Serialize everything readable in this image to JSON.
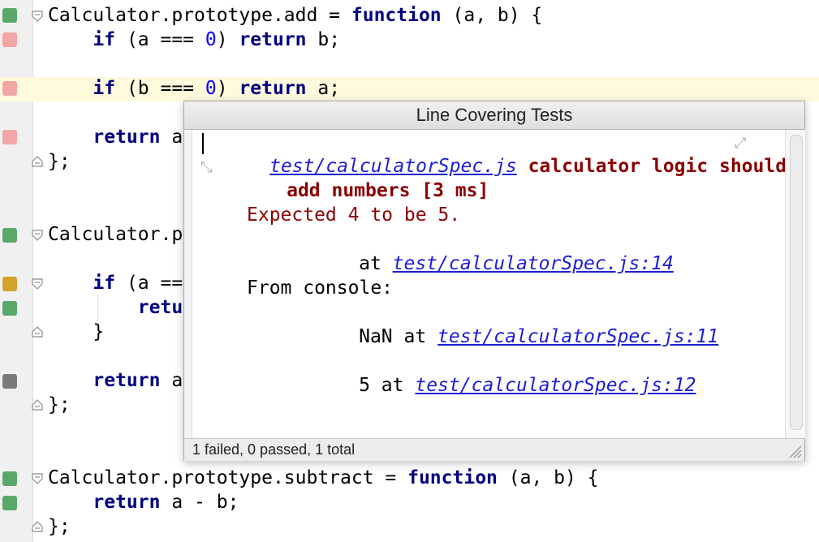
{
  "editor": {
    "lines": [
      {
        "id": "l1",
        "tokens": [
          [
            "",
            "Calculator.prototype.add = "
          ],
          [
            "kw",
            "function"
          ],
          [
            "",
            " (a, b) {"
          ]
        ]
      },
      {
        "id": "l2",
        "tokens": [
          [
            "",
            "    "
          ],
          [
            "kw",
            "if"
          ],
          [
            "",
            " (a === "
          ],
          [
            "num",
            "0"
          ],
          [
            "",
            ") "
          ],
          [
            "kw",
            "return"
          ],
          [
            "",
            " b;"
          ]
        ]
      },
      {
        "id": "l3",
        "tokens": [
          [
            "",
            "    "
          ],
          [
            "kw",
            "if"
          ],
          [
            "",
            " (b === "
          ],
          [
            "num",
            "0"
          ],
          [
            "",
            ") "
          ],
          [
            "kw",
            "return"
          ],
          [
            "",
            " a;"
          ]
        ]
      },
      {
        "id": "l4",
        "tokens": [
          [
            "",
            "    "
          ],
          [
            "kw",
            "return"
          ],
          [
            "",
            " a"
          ]
        ]
      },
      {
        "id": "l5",
        "tokens": [
          [
            "",
            "};"
          ]
        ]
      },
      {
        "id": "l6",
        "tokens": [
          [
            "",
            "Calculator.p"
          ]
        ]
      },
      {
        "id": "l7",
        "tokens": [
          [
            "",
            "    "
          ],
          [
            "kw",
            "if"
          ],
          [
            "",
            " (a =="
          ]
        ]
      },
      {
        "id": "l8",
        "tokens": [
          [
            "",
            "        "
          ],
          [
            "kw",
            "retu"
          ]
        ]
      },
      {
        "id": "l9",
        "tokens": [
          [
            "",
            "    }"
          ]
        ]
      },
      {
        "id": "l10",
        "tokens": [
          [
            "",
            "    "
          ],
          [
            "kw",
            "return"
          ],
          [
            "",
            " a"
          ]
        ]
      },
      {
        "id": "l11",
        "tokens": [
          [
            "",
            "};"
          ]
        ]
      },
      {
        "id": "l12",
        "tokens": [
          [
            "",
            "Calculator.prototype.subtract = "
          ],
          [
            "kw",
            "function"
          ],
          [
            "",
            " (a, b) {"
          ]
        ]
      },
      {
        "id": "l13",
        "tokens": [
          [
            "",
            "    "
          ],
          [
            "kw",
            "return"
          ],
          [
            "",
            " a - b;"
          ]
        ]
      },
      {
        "id": "l14",
        "tokens": [
          [
            "",
            "};"
          ]
        ]
      }
    ]
  },
  "popup": {
    "title": "Line Covering Tests",
    "test_link": "test/calculatorSpec.js",
    "test_name_part1": " calculator logic should",
    "test_name_part2": "add numbers [3 ms]",
    "error_message": "Expected 4 to be 5.",
    "at_label": "at ",
    "stack_link": "test/calculatorSpec.js:14",
    "console_label": "From console:",
    "console_entries": [
      {
        "value": "NaN at ",
        "link": "test/calculatorSpec.js:11"
      },
      {
        "value": "5 at ",
        "link": "test/calculatorSpec.js:12"
      }
    ],
    "status": "1 failed, 0 passed, 1 total"
  },
  "colors": {
    "covered": "#59a869",
    "failed": "#f2a6a6",
    "partial": "#d3a12f",
    "uncovered": "#7a7a7a",
    "keyword": "#000080",
    "number": "#0000ff",
    "link": "#1d1dd6",
    "failure": "#8b0000"
  }
}
